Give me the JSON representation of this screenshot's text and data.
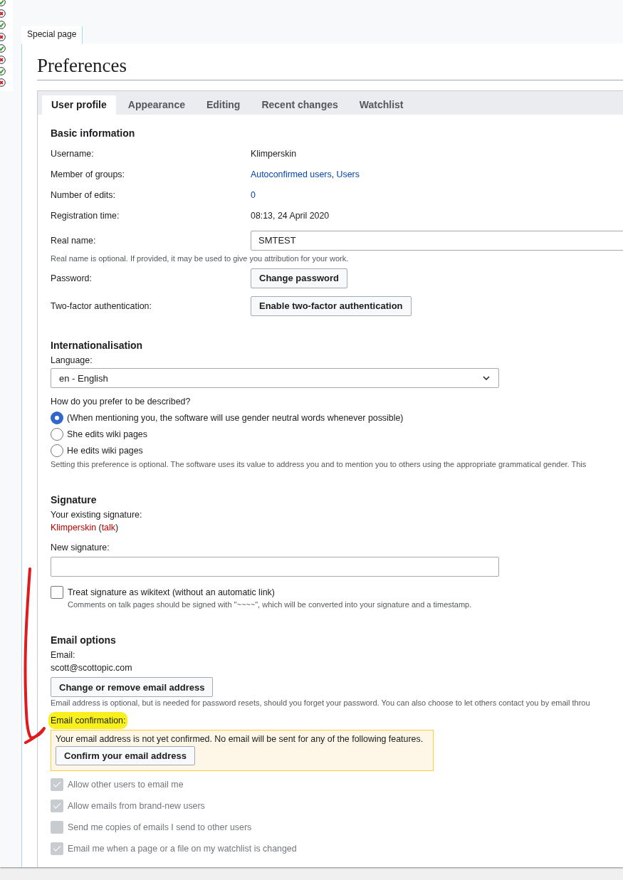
{
  "status_icons": [
    {
      "kind": "ok"
    },
    {
      "kind": "fail"
    },
    {
      "kind": "ok"
    },
    {
      "kind": "fail"
    },
    {
      "kind": "ok"
    },
    {
      "kind": "fail"
    },
    {
      "kind": "ok"
    },
    {
      "kind": "fail"
    }
  ],
  "page_tab": {
    "label": "Special page",
    "selected": true
  },
  "title": "Preferences",
  "tabs": [
    {
      "label": "User profile",
      "selected": true
    },
    {
      "label": "Appearance",
      "selected": false
    },
    {
      "label": "Editing",
      "selected": false
    },
    {
      "label": "Recent changes",
      "selected": false
    },
    {
      "label": "Watchlist",
      "selected": false
    }
  ],
  "basic_information": {
    "heading": "Basic information",
    "rows": [
      {
        "label": "Username:",
        "kind": "text",
        "parts": [
          {
            "text": "Klimperskin",
            "kind": "plain"
          }
        ]
      },
      {
        "label": "Member of groups:",
        "kind": "text",
        "parts": [
          {
            "text": "Autoconfirmed users",
            "kind": "link"
          },
          {
            "text": ", ",
            "kind": "plain"
          },
          {
            "text": "Users",
            "kind": "link"
          }
        ]
      },
      {
        "label": "Number of edits:",
        "kind": "text",
        "parts": [
          {
            "text": "0",
            "kind": "link"
          }
        ]
      },
      {
        "label": "Registration time:",
        "kind": "text",
        "parts": [
          {
            "text": "08:13, 24 April 2020",
            "kind": "plain"
          }
        ]
      },
      {
        "label": "Real name:",
        "kind": "input",
        "value": "SMTEST",
        "help": "Real name is optional. If provided, it may be used to give you attribution for your work."
      },
      {
        "label": "Password:",
        "kind": "button",
        "button": "Change password"
      },
      {
        "label": "Two-factor authentication:",
        "kind": "button",
        "button": "Enable two-factor authentication"
      }
    ]
  },
  "internationalisation": {
    "heading": "Internationalisation",
    "language_label": "Language:",
    "language": "en - English",
    "gender_question": "How do you prefer to be described?",
    "gender_options": [
      {
        "label": "(When mentioning you, the software will use gender neutral words whenever possible)",
        "selected": true
      },
      {
        "label": "She edits wiki pages",
        "selected": false
      },
      {
        "label": "He edits wiki pages",
        "selected": false
      }
    ],
    "help": "Setting this preference is optional. The software uses its value to address you and to mention you to others using the appropriate grammatical gender. This"
  },
  "signature": {
    "heading": "Signature",
    "existing_label": "Your existing signature:",
    "existing": [
      {
        "text": "Klimperskin",
        "kind": "link"
      },
      {
        "text": " (",
        "kind": "plain"
      },
      {
        "text": "talk",
        "kind": "link"
      },
      {
        "text": ")",
        "kind": "plain"
      }
    ],
    "new_label": "New signature:",
    "wikitext": {
      "label": "Treat signature as wikitext (without an automatic link)",
      "checked": false,
      "help": "Comments on talk pages should be signed with \"~~~~\", which will be converted into your signature and a timestamp."
    }
  },
  "email": {
    "heading": "Email options",
    "email_label": "Email:",
    "address": "scott@scottopic.com",
    "change_button": "Change or remove email address",
    "help": "Email address is optional, but is needed for password resets, should you forget your password. You can also choose to let others contact you by email throu",
    "confirmation_label": "Email confirmation:",
    "confirmation_highlighted": true,
    "warning": "Your email address is not yet confirmed. No email will be sent for any of the following features.",
    "confirm_button": "Confirm your email address",
    "options": [
      {
        "label": "Allow other users to email me",
        "checked": true,
        "disabled": true
      },
      {
        "label": "Allow emails from brand-new users",
        "checked": true,
        "disabled": true
      },
      {
        "label": "Send me copies of emails I send to other users",
        "checked": false,
        "disabled": true
      },
      {
        "label": "Email me when a page or a file on my watchlist is changed",
        "checked": true,
        "disabled": true
      }
    ]
  }
}
